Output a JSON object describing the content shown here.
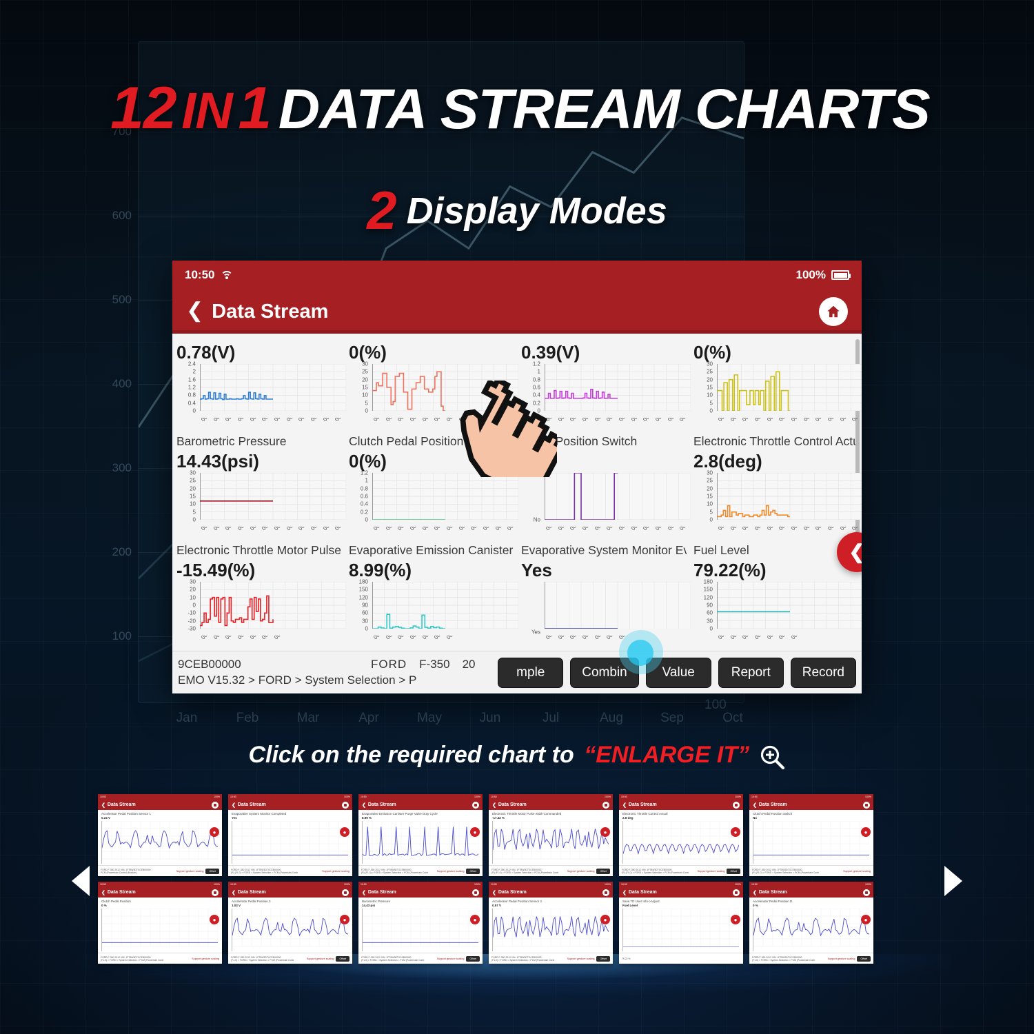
{
  "headline": {
    "num": "12",
    "in_word": "IN",
    "one": "1",
    "rest": "DATA STREAM CHARTS",
    "sub_num": "2",
    "sub_text": "Display Modes"
  },
  "background_chart": {
    "yticks": [
      "700",
      "600",
      "500",
      "400",
      "300",
      "200",
      "100"
    ],
    "months": [
      "Jan",
      "Feb",
      "Mar",
      "Apr",
      "May",
      "Jun",
      "Jul",
      "Aug",
      "Sep",
      "Oct"
    ],
    "extra_value": "100"
  },
  "tablet": {
    "status": {
      "time": "10:50",
      "wifi_icon": "wifi-icon",
      "battery_text": "100%",
      "battery_icon": "battery-full-icon"
    },
    "nav": {
      "back_icon": "chevron-left-icon",
      "title": "Data Stream",
      "home_icon": "home-icon"
    },
    "side_tab_icon": "chevron-left-icon",
    "bottom": {
      "vin": "9CEB00000",
      "make": "FORD",
      "model": "F-350",
      "year": "20",
      "breadcrumb": "EMO V15.32 > FORD > System Selection > P",
      "buttons": [
        "mple",
        "Combin",
        "Value",
        "Report",
        "Record"
      ]
    }
  },
  "chart_data": [
    {
      "type": "line",
      "title": "Barometric Pressure",
      "value_label": "0.78(V)",
      "color": "#2e7ed8",
      "ylabel": "",
      "xlabel": "",
      "yticks": [
        "0",
        "0.4",
        "0.8",
        "1.2",
        "1.6",
        "2",
        "2.4"
      ],
      "ylim": [
        0,
        2.4
      ],
      "xticks": [
        "00:00",
        "00:05",
        "00:10",
        "00:15",
        "00:20",
        "00:25",
        "00:30",
        "00:35",
        "00:40",
        "00:45",
        "00:50",
        "00:55",
        "01:00"
      ],
      "values": [
        0.6,
        0.62,
        0.78,
        0.6,
        0.62,
        0.95,
        0.62,
        0.6,
        0.92,
        0.6,
        0.62,
        0.9,
        0.62,
        0.58,
        0.85,
        0.6,
        0.6,
        0.62,
        0.6,
        0.6,
        0.6,
        0.62,
        0.6,
        0.6,
        0.62,
        0.78,
        0.62,
        0.6,
        0.95,
        0.62,
        0.6,
        0.92,
        0.62,
        0.6,
        0.85,
        0.62,
        0.6,
        0.78,
        0.6,
        0.6,
        0.6,
        0.6,
        0.6
      ]
    },
    {
      "type": "line",
      "title": "Clutch Pedal Position",
      "value_label": "0(%)",
      "color": "#f0715c",
      "yticks": [
        "0",
        "5",
        "10",
        "15",
        "20",
        "25",
        "30"
      ],
      "ylim": [
        0,
        30
      ],
      "xticks": [
        "00:00",
        "00:05",
        "00:10",
        "00:15",
        "00:20",
        "00:25",
        "00:30",
        "00:35",
        "00:40",
        "00:45",
        "00:50",
        "00:55",
        "01:00"
      ],
      "values": [
        13,
        13,
        18,
        16,
        16,
        24,
        24,
        15,
        15,
        4,
        6,
        22,
        22,
        24,
        24,
        12,
        12,
        1,
        1,
        14,
        14,
        18,
        18,
        22,
        22,
        14,
        14,
        12,
        12,
        14,
        22,
        25,
        25,
        3,
        0,
        0
      ]
    },
    {
      "type": "line",
      "title": "Pedal Position Switch",
      "value_label": "0.39(V)",
      "color": "#c33bd8",
      "yticks": [
        "0",
        "0.2",
        "0.4",
        "0.6",
        "0.8",
        "1",
        "1.2"
      ],
      "ylim": [
        0,
        1.2
      ],
      "xticks": [
        "00:00",
        "00:05",
        "00:10",
        "00:15",
        "00:20",
        "00:25",
        "00:30",
        "00:35",
        "00:40",
        "00:45",
        "00:50",
        "00:55",
        "01:00"
      ],
      "values": [
        0.32,
        0.32,
        0.45,
        0.32,
        0.32,
        0.52,
        0.32,
        0.33,
        0.5,
        0.32,
        0.33,
        0.5,
        0.33,
        0.32,
        0.45,
        0.32,
        0.32,
        0.32,
        0.32,
        0.32,
        0.33,
        0.45,
        0.33,
        0.32,
        0.55,
        0.33,
        0.32,
        0.5,
        0.32,
        0.33,
        0.48,
        0.32,
        0.32,
        0.42,
        0.32,
        0.32,
        0.32,
        0.32,
        0.32
      ]
    },
    {
      "type": "line",
      "title": "Electronic Throttle Control Actual",
      "value_label": "0(%)",
      "color": "#ccc117",
      "yticks": [
        "0",
        "5",
        "10",
        "15",
        "20",
        "25",
        "30"
      ],
      "ylim": [
        0,
        30
      ],
      "xticks": [
        "00:00",
        "00:05",
        "00:10",
        "00:15",
        "00:20",
        "00:25",
        "00:30",
        "00:35",
        "00:40",
        "00:45",
        "00:50",
        "00:55",
        "01:00"
      ],
      "values": [
        13,
        13,
        13,
        0,
        18,
        18,
        0,
        20,
        20,
        0,
        23,
        23,
        0,
        13,
        13,
        13,
        13,
        4,
        4,
        13,
        13,
        4,
        13,
        13,
        4,
        13,
        13,
        0,
        19,
        19,
        0,
        22,
        22,
        0,
        25,
        25,
        0,
        13,
        13,
        13,
        13,
        0,
        0
      ]
    },
    {
      "type": "line",
      "title": "Electronic Throttle Motor Pulse...",
      "value_label": "14.43(psi)",
      "color": "#9d1324",
      "yticks": [
        "0",
        "5",
        "10",
        "15",
        "20",
        "25",
        "30"
      ],
      "ylim": [
        0,
        30
      ],
      "xticks": [
        "00:00",
        "00:05",
        "00:10",
        "00:15",
        "00:20",
        "00:25",
        "00:30",
        "00:35",
        "00:40",
        "00:45",
        "00:50",
        "00:55",
        "01:00"
      ],
      "values": [
        12,
        12,
        12,
        12,
        12,
        12,
        12,
        12,
        12,
        12,
        12,
        12,
        12,
        12,
        12,
        12,
        12,
        12,
        12
      ]
    },
    {
      "type": "line",
      "title": "Evaporative Emission Canister P...",
      "value_label": "0(%)",
      "color": "#3ec97d",
      "yticks": [
        "0",
        "0.2",
        "0.4",
        "0.6",
        "0.8",
        "1",
        "1.2"
      ],
      "ylim": [
        0,
        1.2
      ],
      "xticks": [
        "00:00",
        "00:05",
        "00:10",
        "00:15",
        "00:20",
        "00:25",
        "00:30",
        "00:35",
        "00:40",
        "00:45",
        "00:50",
        "00:55",
        "01:00"
      ],
      "values": [
        0,
        0,
        0,
        0,
        0,
        0,
        0,
        0,
        0,
        0,
        0,
        0,
        0,
        0,
        0,
        0,
        0,
        0,
        0
      ]
    },
    {
      "type": "line",
      "title": "Evaporative System Monitor Eva...",
      "value_label": "Yes",
      "color": "#7b2ea8",
      "yticks": [
        "No",
        "Yes"
      ],
      "ylim": [
        0,
        1
      ],
      "xticks": [
        "00:00",
        "00:05",
        "00:10",
        "00:15",
        "00:20",
        "00:25",
        "00:30",
        "00:35",
        "00:40",
        "00:45",
        "00:50",
        "00:55",
        "01:00"
      ],
      "values": [
        0,
        0,
        0,
        0,
        0,
        0,
        0,
        0,
        0,
        1,
        1,
        0,
        0,
        0,
        0,
        0,
        0,
        0,
        0,
        0,
        0,
        1,
        1
      ]
    },
    {
      "type": "line",
      "title": "Fuel Level",
      "value_label": "2.8(deg)",
      "color": "#f0892a",
      "yticks": [
        "0",
        "5",
        "10",
        "15",
        "20",
        "25",
        "30"
      ],
      "ylim": [
        0,
        30
      ],
      "xticks": [
        "00:00",
        "00:05",
        "00:10",
        "00:15",
        "00:20",
        "00:25",
        "00:30",
        "00:35",
        "00:40",
        "00:45",
        "00:50",
        "00:55",
        "01:00"
      ],
      "values": [
        2,
        2,
        3,
        6,
        2,
        9,
        2,
        5,
        5,
        3,
        4,
        4,
        2,
        3,
        3,
        2,
        2,
        3,
        3,
        2,
        3,
        6,
        3,
        9,
        3,
        5,
        6,
        4,
        3,
        3,
        3,
        3,
        3,
        2,
        2
      ]
    },
    {
      "type": "line",
      "title": "",
      "value_label": "-15.49(%)",
      "color": "#e81f24",
      "yticks": [
        "-30",
        "-20",
        "-10",
        "0",
        "10",
        "20",
        "30"
      ],
      "ylim": [
        -30,
        30
      ],
      "xticks": [
        "00:00",
        "00:05",
        "00:10",
        "00:15",
        "00:20",
        "00:25",
        "00:30"
      ],
      "values": [
        -26,
        -22,
        -10,
        -22,
        -18,
        8,
        10,
        -14,
        10,
        -22,
        8,
        10,
        -26,
        -10,
        10,
        -20,
        -22,
        -18,
        -18,
        -16,
        -22,
        -18,
        -18,
        -2,
        8,
        -18,
        10,
        -8,
        8,
        -20,
        -18,
        -10,
        12,
        -22,
        -22,
        -18
      ]
    },
    {
      "type": "line",
      "title": "",
      "value_label": "8.99(%)",
      "color": "#2fc6c6",
      "yticks": [
        "0",
        "30",
        "60",
        "90",
        "120",
        "150",
        "180"
      ],
      "ylim": [
        0,
        180
      ],
      "xticks": [
        "00:00",
        "00:05",
        "00:10",
        "00:15",
        "00:20",
        "00:25",
        "00:30"
      ],
      "values": [
        0,
        0,
        6,
        3,
        0,
        55,
        2,
        6,
        8,
        5,
        2,
        0,
        0,
        3,
        10,
        6,
        0,
        52,
        5,
        2,
        8,
        4,
        6,
        2,
        0,
        0
      ]
    },
    {
      "type": "line",
      "title": "",
      "value_label": "Yes",
      "color": "#2a2aa8",
      "yticks": [
        "Yes"
      ],
      "ylim": [
        0,
        1
      ],
      "xticks": [
        "00:00",
        "00:05",
        "00:10",
        "00:15",
        "00:20",
        "00:25",
        "00:30"
      ],
      "values": [
        0,
        0,
        0,
        0,
        0,
        0,
        0,
        0,
        0,
        0,
        0,
        0
      ]
    },
    {
      "type": "line",
      "title": "",
      "value_label": "79.22(%)",
      "color": "#21b5b5",
      "yticks": [
        "0",
        "30",
        "60",
        "90",
        "120",
        "150",
        "180"
      ],
      "ylim": [
        0,
        180
      ],
      "xticks": [
        "00:00",
        "00:05",
        "00:10",
        "00:15",
        "00:20",
        "00:25",
        "00:30"
      ],
      "values": [
        65,
        65,
        65,
        65,
        65,
        65,
        65,
        65,
        65,
        65,
        65,
        65
      ]
    }
  ],
  "cta": {
    "text_before": "Click on the required chart to",
    "text_highlight": "“ENLARGE IT”",
    "icon": "magnifier-plus-icon"
  },
  "strip": {
    "arrow_left_icon": "triangle-left-icon",
    "arrow_right_icon": "triangle-right-icon",
    "thumbnails": [
      {
        "nav_title": "Data Stream",
        "name": "Accelerator Pedal Position Sensor 1",
        "value": "0.24  V",
        "footer1": "FORD  F-350  2012  VIN: 1FT8W3DTXCEB00000",
        "footer2": "PCM (Powertrain Control) Module)",
        "gesture": "Support gesture scaling",
        "button": "Offset",
        "color": "#4a4ad0",
        "wave": "saw"
      },
      {
        "nav_title": "Data Stream",
        "name": "Evaporative System Monitor Completed",
        "value": "Yes",
        "footer1": "FORD  F-350  2012  VIN: 1FT8W3DTXCEB00000",
        "footer2": "(R) (F1.0) > FORD > System Selection > PCM (Powertrain Contr",
        "gesture": "Support gesture scaling",
        "button": "",
        "color": "#4a4ad0",
        "wave": "flat"
      },
      {
        "nav_title": "Data Stream",
        "name": "Evaporative Emission Canister Purge Valve Duty Cycle",
        "value": "8.99  %",
        "footer1": "FORD  F-350  2012  VIN: 1FT8W3DTXCEB00000",
        "footer2": "(R) (F1.0) > FORD > System Selection > PCM (Powertrain Contr",
        "gesture": "Support gesture scaling",
        "button": "Offset",
        "color": "#4a4ad0",
        "wave": "spike"
      },
      {
        "nav_title": "Data Stream",
        "name": "Electronic Throttle Motor Pulse width Commanded",
        "value": "-17.42  %",
        "footer1": "FORD  F-350  2012  VIN: 1FT8W3DTXCEB00000",
        "footer2": "(R) (F1.0) > FORD > System Selection > PCM (Powertrain Contr",
        "gesture": "Support gesture scaling",
        "button": "Offset",
        "color": "#4a4ad0",
        "wave": "dense"
      },
      {
        "nav_title": "Data Stream",
        "name": "Electronic Throttle Control Actual",
        "value": "2.8  deg",
        "footer1": "FORD  F-350  2012  VIN: 1FT8W3DTXCEB00000",
        "footer2": "(R) (F1.0) > FORD > System Selection > PCM (Powertrain Contr",
        "gesture": "Support gesture scaling",
        "button": "Offset",
        "color": "#4a4ad0",
        "wave": "low"
      },
      {
        "nav_title": "Data Stream",
        "name": "Clutch Pedal Position Switch",
        "value": "No",
        "footer1": "FORD  F-350  2012  VIN: 1FT8W3DTXCEB00000",
        "footer2": "(R) (F1.0) > FORD > System Selection > PCM (Powertrain Contr",
        "gesture": "Support gesture scaling",
        "button": "",
        "color": "#4a4ad0",
        "wave": "flat"
      },
      {
        "nav_title": "Data Stream",
        "name": "Clutch Pedal Position",
        "value": "0  %",
        "footer1": "FORD  F-350  2012  VIN: 1FT8W3DTXCEB00000",
        "footer2": "(F1.0) > FORD > System Selection > PCM (Powertrain Contr",
        "gesture": "Support gesture scaling",
        "button": "",
        "color": "#4a4ad0",
        "wave": "flat"
      },
      {
        "nav_title": "Data Stream",
        "name": "Accelerator Pedal Position 3",
        "value": "1.03  V",
        "footer1": "FORD  F-350  2012  VIN: 1FT8W3DTXCEB00000",
        "footer2": "(F1.0) > FORD > System Selection > PCM (Powertrain Contr",
        "gesture": "Support gesture scaling",
        "button": "Offset",
        "color": "#4a4ad0",
        "wave": "saw"
      },
      {
        "nav_title": "Data Stream",
        "name": "Barometric Pressure",
        "value": "14.43  psi",
        "footer1": "FORD  F-350  2012  VIN: 1FT8W3DTXCEB00000",
        "footer2": "(F1.0) > FORD > System Selection > PCM (Powertrain Contr",
        "gesture": "Support gesture scaling",
        "button": "Offset",
        "color": "#4a4ad0",
        "wave": "flat"
      },
      {
        "nav_title": "Data Stream",
        "name": "Accelerator Pedal Position Sensor 2",
        "value": "0.57  V",
        "footer1": "FORD  F-350  2012  VIN: 1FT8W3DTXCEB00000",
        "footer2": "(F1.0) > FORD > System Selection > PCM (Powertrain Contr",
        "gesture": "Support gesture scaling",
        "button": "Offset",
        "color": "#4a4ad0",
        "wave": "dense"
      },
      {
        "nav_title": "Data Stream",
        "name": "Save TD User Info->Adjust",
        "value": "Fuel Level",
        "footer1": "79.22  %",
        "footer2": "",
        "gesture": "",
        "button": "",
        "color": "#4a4ad0",
        "wave": "none"
      },
      {
        "nav_title": "Data Stream",
        "name": "Accelerator Pedal Position D",
        "value": "0  %",
        "footer1": "FORD  F-350  2012  VIN: 1FT8W3DTXCEB00000",
        "footer2": "(F1.0) > FORD > System Selection > PCM (Powertrain Contr",
        "gesture": "Support gesture scaling",
        "button": "Offset",
        "color": "#4a4ad0",
        "wave": "saw"
      }
    ]
  }
}
